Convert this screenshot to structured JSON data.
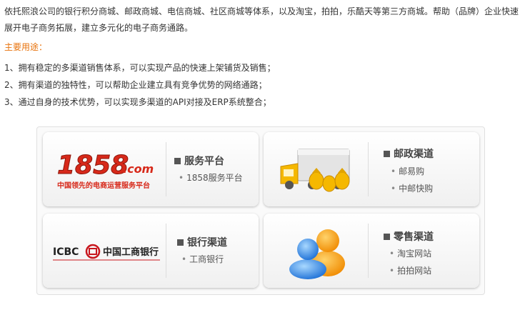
{
  "intro": "依托熙浪公司的银行积分商城、邮政商城、电信商城、社区商城等体系，以及淘宝，拍拍，乐酷天等第三方商城。帮助（品牌）企业快速展开电子商务拓展，建立多元化的电子商务通路。",
  "heading": "主要用途：",
  "uses": [
    "1、拥有稳定的多渠道销售体系，可以实现产品的快速上架铺货及销售；",
    "2、拥有渠道的独特性，可以帮助企业建立具有竞争优势的网络通路；",
    "3、通过自身的技术优势，可以实现多渠道的API对接及ERP系统整合；"
  ],
  "cards": {
    "service": {
      "logo_text": "1858",
      "logo_suffix": ".com",
      "logo_tagline": "中国领先的电商运营服务平台",
      "title": "服务平台",
      "items": [
        "1858服务平台"
      ]
    },
    "postal": {
      "title": "邮政渠道",
      "items": [
        "邮易购",
        "中邮快购"
      ]
    },
    "bank": {
      "logo_en": "ICBC",
      "logo_cn": "中国工商银行",
      "title": "银行渠道",
      "items": [
        "工商银行"
      ]
    },
    "retail": {
      "title": "零售渠道",
      "items": [
        "淘宝网站",
        "拍拍网站"
      ]
    }
  },
  "colors": {
    "accent_orange": "#e8730c",
    "logo_red": "#d7291a",
    "truck_yellow": "#f5b800"
  }
}
